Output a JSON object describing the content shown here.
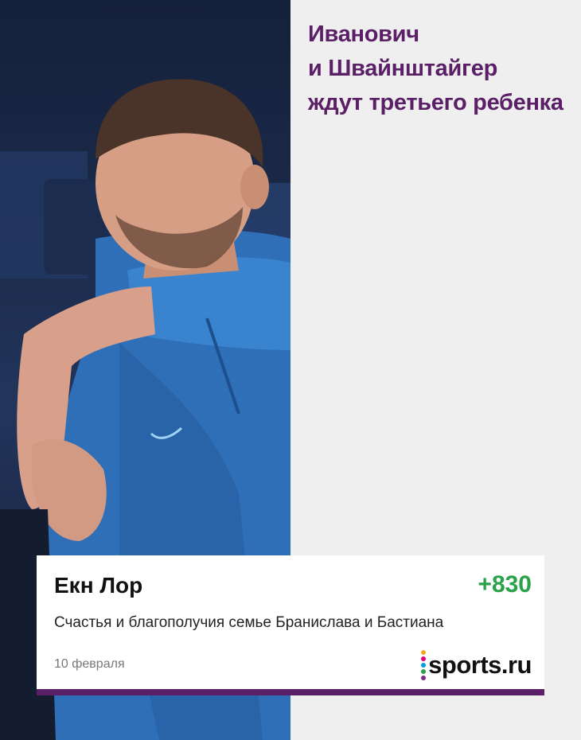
{
  "headline": {
    "lines": [
      "Иванович",
      "и Швайнштайгер",
      "ждут третьего ребенка"
    ],
    "color": "#5a1f66"
  },
  "photo": {
    "alt_icon": "player-photo"
  },
  "comment_card": {
    "author": "Екн Лор",
    "score": "+830",
    "score_color": "#2aa24a",
    "text": "Счастья и благополучия семье Бранислава и Бастиана",
    "date": "10 февраля",
    "logo_text": "sports.ru",
    "logo_dot_colors": [
      "#f5a623",
      "#e6007e",
      "#00a0e3",
      "#2aa24a",
      "#7b2d8e"
    ],
    "accent": "#5a1f66"
  }
}
